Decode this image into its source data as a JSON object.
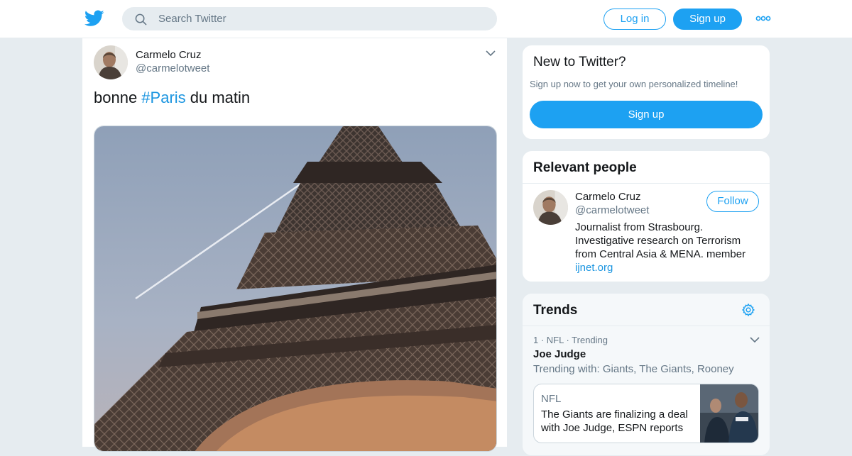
{
  "header": {
    "search_placeholder": "Search Twitter",
    "login_label": "Log in",
    "signup_label": "Sign up",
    "brand_color": "#1da1f2"
  },
  "tweet": {
    "author_name": "Carmelo Cruz",
    "author_handle": "@carmelotweet",
    "text_before": "bonne ",
    "hashtag": "#Paris",
    "text_after": " du matin",
    "media_icon": "eiffel-tower-photo"
  },
  "new_to_twitter": {
    "title": "New to Twitter?",
    "subtitle": "Sign up now to get your own personalized timeline!",
    "button_label": "Sign up"
  },
  "relevant_people": {
    "title": "Relevant people",
    "person": {
      "name": "Carmelo Cruz",
      "handle": "@carmelotweet",
      "follow_label": "Follow",
      "bio": "Journalist from Strasbourg. Investigative research on Terrorism from Central Asia & MENA. member",
      "bio_link": "ijnet.org"
    }
  },
  "trends": {
    "title": "Trends",
    "items": [
      {
        "meta": "1 · NFL · Trending",
        "name": "Joe Judge",
        "trending_with": "Trending with: Giants, The Giants, Rooney",
        "news": {
          "source": "NFL",
          "headline": "The Giants are finalizing a deal with Joe Judge, ESPN reports"
        }
      }
    ]
  }
}
